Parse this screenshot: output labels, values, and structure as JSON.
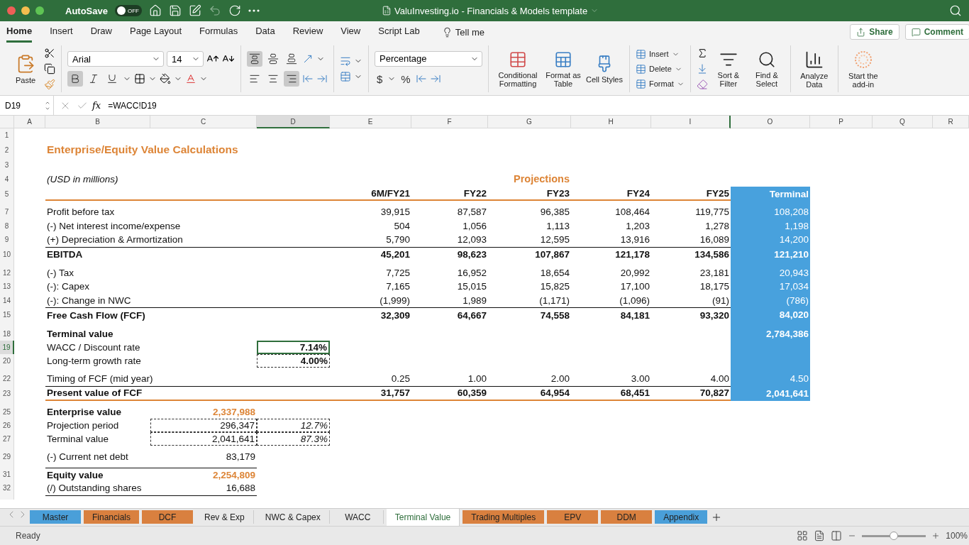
{
  "title_bar": {
    "autosave_label": "AutoSave",
    "autosave_state": "OFF",
    "autosave_on": false,
    "title": "ValuInvesting.io - Financials & Models template"
  },
  "menu_tabs": [
    {
      "label": "Home",
      "selected": true
    },
    {
      "label": "Insert",
      "selected": false
    },
    {
      "label": "Draw",
      "selected": false
    },
    {
      "label": "Page Layout",
      "selected": false
    },
    {
      "label": "Formulas",
      "selected": false
    },
    {
      "label": "Data",
      "selected": false
    },
    {
      "label": "Review",
      "selected": false
    },
    {
      "label": "View",
      "selected": false
    },
    {
      "label": "Script Lab",
      "selected": false
    }
  ],
  "tell_me": "Tell me",
  "share": "Share",
  "comments": "Comment",
  "ribbon": {
    "paste": "Paste",
    "font": "Arial",
    "font_size": "14",
    "bold_on": true,
    "italic_on": false,
    "underline_on": false,
    "align_top_on": true,
    "align_right_on": true,
    "number_format": "Percentage",
    "currency": "$",
    "percent": "%",
    "styles": [
      "Conditional Formatting",
      "Format as Table",
      "Cell Styles"
    ],
    "cells": [
      "Insert",
      "Delete",
      "Format"
    ],
    "editing": [
      "Sort & Filter",
      "Find & Select"
    ],
    "analyze": "Analyze Data",
    "addin": "Start the add-in"
  },
  "formula_bar": {
    "cell": "D19",
    "fx": "fx",
    "formula": "=WACC!D19"
  },
  "columns": [
    {
      "label": "A",
      "selected": false
    },
    {
      "label": "B",
      "selected": false
    },
    {
      "label": "C",
      "selected": false
    },
    {
      "label": "D",
      "selected": true
    },
    {
      "label": "E",
      "selected": false
    },
    {
      "label": "F",
      "selected": false
    },
    {
      "label": "G",
      "selected": false
    },
    {
      "label": "H",
      "selected": false
    },
    {
      "label": "I",
      "selected": false
    },
    {
      "label": "O",
      "selected": false
    },
    {
      "label": "P",
      "selected": false
    },
    {
      "label": "Q",
      "selected": false
    },
    {
      "label": "R",
      "selected": false
    }
  ],
  "rows": [
    {
      "num": "1",
      "kind": "blank"
    },
    {
      "num": "2",
      "kind": "title",
      "label": "Enterprise/Equity Value Calculations"
    },
    {
      "num": "3",
      "kind": "blank"
    },
    {
      "num": "4",
      "kind": "units",
      "label": "(USD in millions)",
      "projections": "Projections"
    },
    {
      "num": "5",
      "kind": "header",
      "values": [
        "6M/FY21",
        "FY22",
        "FY23",
        "FY24",
        "FY25"
      ],
      "terminal": "Terminal",
      "band": true,
      "rule_below": true
    },
    {
      "kind": "spacer",
      "band": true
    },
    {
      "num": "7",
      "kind": "item",
      "label": "Profit before tax",
      "values": [
        "39,915",
        "87,587",
        "96,385",
        "108,464",
        "119,775"
      ],
      "terminal": "108,208",
      "band": true
    },
    {
      "num": "8",
      "kind": "item",
      "label": "(-) Net interest income/expense",
      "values": [
        "504",
        "1,056",
        "1,113",
        "1,203",
        "1,278"
      ],
      "terminal": "1,198",
      "band": true
    },
    {
      "num": "9",
      "kind": "item",
      "label": "(+) Depreciation & Armortization",
      "values": [
        "5,790",
        "12,093",
        "12,595",
        "13,916",
        "16,089"
      ],
      "terminal": "14,200",
      "band": true
    },
    {
      "num": "10",
      "kind": "total",
      "label": "EBITDA",
      "values": [
        "45,201",
        "98,623",
        "107,867",
        "121,178",
        "134,586"
      ],
      "terminal": "121,210",
      "band": true,
      "rule_above": true
    },
    {
      "kind": "spacer",
      "band": true
    },
    {
      "num": "12",
      "kind": "item",
      "label": "(-) Tax",
      "values": [
        "7,725",
        "16,952",
        "18,654",
        "20,992",
        "23,181"
      ],
      "terminal": "20,943",
      "band": true
    },
    {
      "num": "13",
      "kind": "item",
      "label": "(-): Capex",
      "values": [
        "7,165",
        "15,015",
        "15,825",
        "17,100",
        "18,175"
      ],
      "terminal": "17,034",
      "band": true
    },
    {
      "num": "14",
      "kind": "item",
      "label": "(-): Change in NWC",
      "values": [
        "(1,999)",
        "1,989",
        "(1,171)",
        "(1,096)",
        "(91)"
      ],
      "terminal": "(786)",
      "band": true
    },
    {
      "num": "15",
      "kind": "total",
      "label": "Free Cash Flow (FCF)",
      "values": [
        "32,309",
        "64,667",
        "74,558",
        "84,181",
        "93,320"
      ],
      "terminal": "84,020",
      "band": true,
      "rule_above": true
    },
    {
      "kind": "spacer",
      "band": true
    },
    {
      "num": "18",
      "kind": "section",
      "label": "Terminal value",
      "terminal": "2,784,386",
      "band": true
    },
    {
      "num": "19",
      "kind": "input",
      "label": "WACC / Discount rate",
      "d": {
        "text": "7.14%",
        "selected": true
      },
      "band": true
    },
    {
      "num": "20",
      "kind": "input",
      "label": "Long-term growth rate",
      "d": {
        "text": "4.00%",
        "selected": false
      },
      "band": true
    },
    {
      "kind": "spacer",
      "band": true
    },
    {
      "num": "22",
      "kind": "item",
      "label": "Timing of FCF (mid year)",
      "values": [
        "0.25",
        "1.00",
        "2.00",
        "3.00",
        "4.00"
      ],
      "terminal": "4.50",
      "band": true
    },
    {
      "num": "23",
      "kind": "total",
      "label": "Present value of FCF",
      "values": [
        "31,757",
        "60,359",
        "64,954",
        "68,451",
        "70,827"
      ],
      "terminal": "2,041,641",
      "band": true,
      "rule_above": true,
      "rule_below": true
    },
    {
      "kind": "spacer"
    },
    {
      "num": "25",
      "kind": "result",
      "label": "Enterprise value",
      "c": "2,337,988"
    },
    {
      "num": "26",
      "kind": "split",
      "label": "Projection period",
      "c": "296,347",
      "d": {
        "text": "12.7%",
        "selected": false
      }
    },
    {
      "num": "27",
      "kind": "split",
      "label": "Terminal value",
      "c": "2,041,641",
      "d": {
        "text": "87.3%",
        "selected": false
      }
    },
    {
      "kind": "spacer"
    },
    {
      "num": "29",
      "kind": "item",
      "label": "(-) Current net debt",
      "c": "83,179"
    },
    {
      "kind": "spacer"
    },
    {
      "num": "31",
      "kind": "result",
      "label": "Equity value",
      "c": "2,254,809",
      "rule_above": true
    },
    {
      "num": "32",
      "kind": "item",
      "label": "(/) Outstanding shares",
      "c": "16,688"
    },
    {
      "kind": "spacer",
      "rule_above": true
    }
  ],
  "sheet_tabs": [
    {
      "label": "Master",
      "color": "#4a9fd9",
      "selected": false
    },
    {
      "label": "Financials",
      "color": "#d9803f",
      "selected": false
    },
    {
      "label": "DCF",
      "color": "#d9803f",
      "selected": false
    },
    {
      "label": "Rev & Exp",
      "selected": false
    },
    {
      "label": "NWC & Capex",
      "selected": false
    },
    {
      "label": "WACC",
      "selected": false
    },
    {
      "label": "Terminal Value",
      "selected": true
    },
    {
      "label": "Trading Multiples",
      "color": "#d9803f",
      "selected": false
    },
    {
      "label": "EPV",
      "color": "#d9803f",
      "selected": false
    },
    {
      "label": "DDM",
      "color": "#d9803f",
      "selected": false
    },
    {
      "label": "Appendix",
      "color": "#4a9fd9",
      "selected": false
    }
  ],
  "status_bar": {
    "status": "Ready",
    "zoom": "100%",
    "level": 0.5
  }
}
